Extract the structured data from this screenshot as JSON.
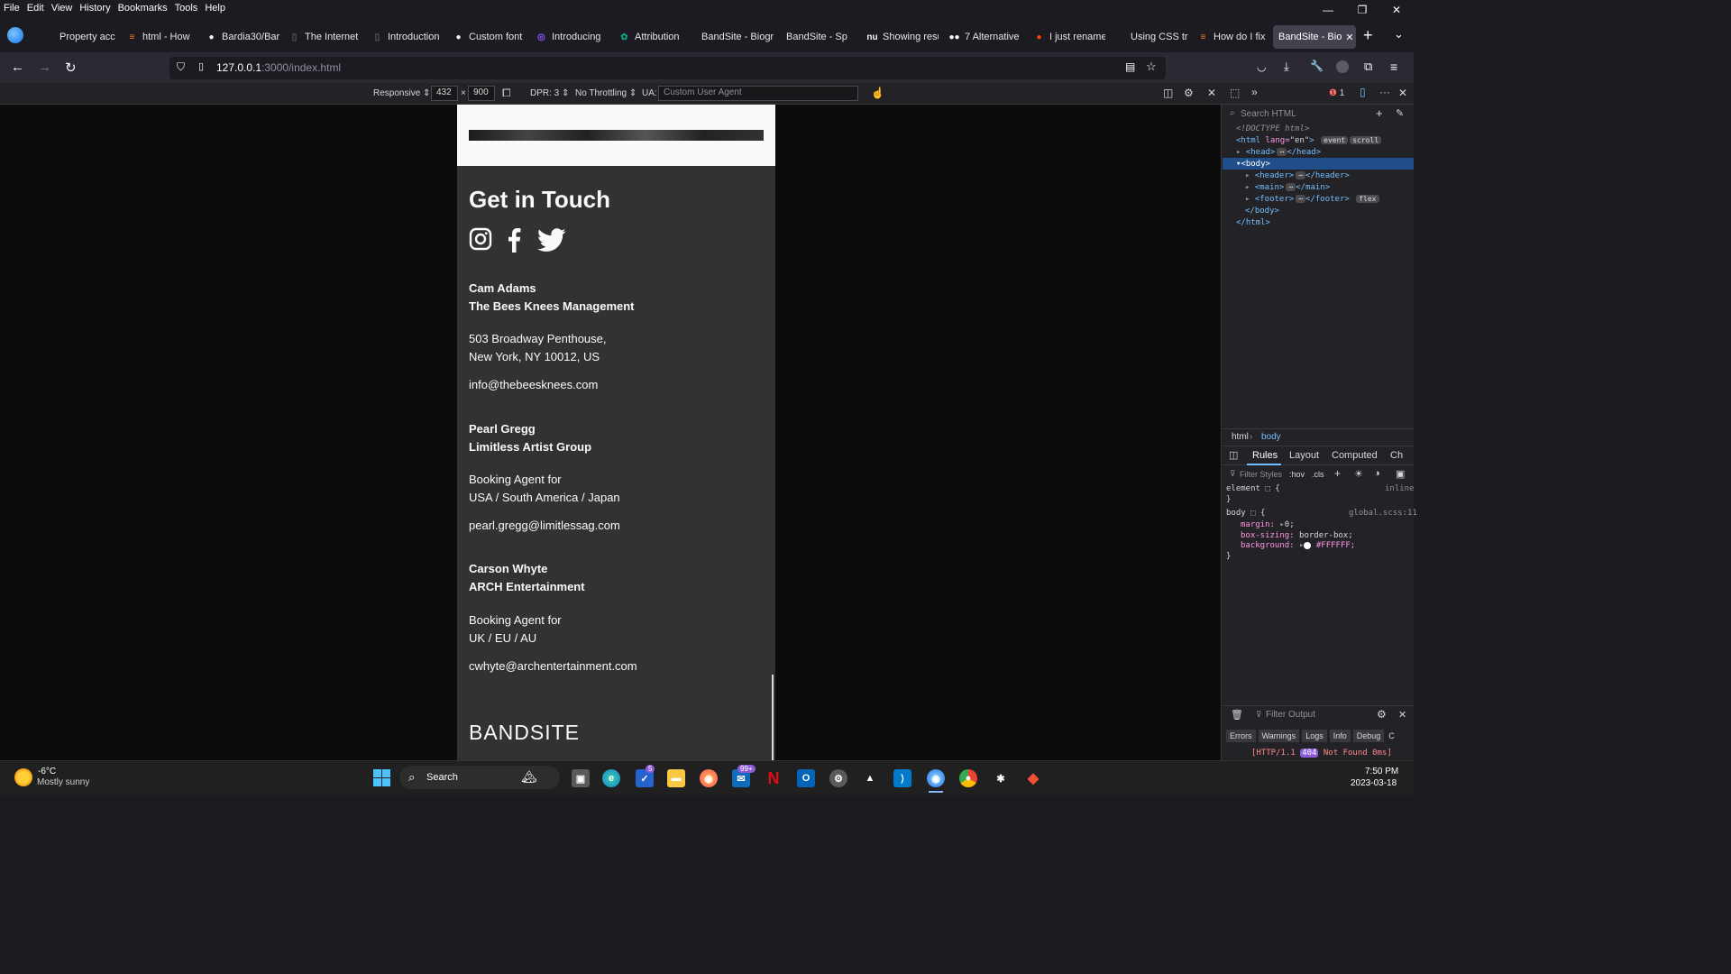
{
  "menu": [
    "File",
    "Edit",
    "View",
    "History",
    "Bookmarks",
    "Tools",
    "Help"
  ],
  "window_controls": {
    "minimize": "—",
    "restore": "❐",
    "close": "✕"
  },
  "tabs": [
    {
      "label": "Property acc",
      "icon": "medium-icon",
      "glyph": "M",
      "color": "#1c1b22"
    },
    {
      "label": "html - How",
      "icon": "stackoverflow-icon",
      "glyph": "≡",
      "color": "#f48024"
    },
    {
      "label": "Bardia30/Bar",
      "icon": "github-icon",
      "glyph": "●",
      "color": "#fbfbfe"
    },
    {
      "label": "The Internet",
      "icon": "page-icon",
      "glyph": "▯",
      "color": "#5b5b66"
    },
    {
      "label": "Introduction",
      "icon": "page-icon",
      "glyph": "▯",
      "color": "#5b5b66"
    },
    {
      "label": "Custom font",
      "icon": "github-icon",
      "glyph": "●",
      "color": "#fbfbfe"
    },
    {
      "label": "Introducing",
      "icon": "firefox-icon",
      "glyph": "◎",
      "color": "#9059ff"
    },
    {
      "label": "Attribution",
      "icon": "chatgpt-icon",
      "glyph": "✿",
      "color": "#10a37f"
    },
    {
      "label": "BandSite - Biogr",
      "icon": "",
      "glyph": "",
      "color": ""
    },
    {
      "label": "BandSite - Sp",
      "icon": "",
      "glyph": "",
      "color": ""
    },
    {
      "label": "Showing resu",
      "icon": "notion-icon",
      "glyph": "nu",
      "color": "#fbfbfe"
    },
    {
      "label": "7 Alternative",
      "icon": "medium-icon",
      "glyph": "●●",
      "color": "#fbfbfe"
    },
    {
      "label": "I just rename",
      "icon": "reddit-icon",
      "glyph": "●",
      "color": "#ff4500"
    },
    {
      "label": "Using CSS tra",
      "icon": "medium-icon",
      "glyph": "M",
      "color": "#1c1b22"
    },
    {
      "label": "How do I fix",
      "icon": "stackoverflow-icon",
      "glyph": "≡",
      "color": "#f48024"
    },
    {
      "label": "BandSite - Bio",
      "icon": "",
      "glyph": "",
      "color": ""
    }
  ],
  "url": {
    "host": "127.0.0.1",
    "rest": ":3000/index.html"
  },
  "rdm": {
    "device": "Responsive",
    "width": "432",
    "height": "900",
    "dpr": "DPR: 3",
    "throttle": "No Throttling",
    "ua_label": "UA:",
    "ua_placeholder": "Custom User Agent"
  },
  "site": {
    "heading": "Get in Touch",
    "contacts": [
      {
        "name": "Cam Adams",
        "org": "The Bees Knees Management",
        "line1": "503 Broadway Penthouse,",
        "line2": "New York, NY 10012, US",
        "email": "info@thebeesknees.com"
      },
      {
        "name": "Pearl Gregg",
        "org": "Limitless Artist Group",
        "line1": "Booking Agent for",
        "line2": "USA / South America / Japan",
        "email": "pearl.gregg@limitlessag.com"
      },
      {
        "name": "Carson Whyte",
        "org": "ARCH Entertainment",
        "line1": "Booking Agent for",
        "line2": "UK / EU / AU",
        "email": "cwhyte@archentertainment.com"
      }
    ],
    "logo": "BANDSITE"
  },
  "devtools": {
    "search_placeholder": "Search HTML",
    "tree": {
      "doctype": "<!DOCTYPE html>",
      "html_open": "<html",
      "lang_attr": "lang=",
      "lang_val": "\"en\"",
      "html_close": ">",
      "event": "event",
      "scroll": "scroll",
      "head": "<head>",
      "head_close": "</head>",
      "body": "<body>",
      "header": "<header>",
      "header_close": "</header>",
      "main": "<main>",
      "main_close": "</main>",
      "footer": "<footer>",
      "footer_close": "</footer>",
      "flex": "flex",
      "body_close": "</body>",
      "html_end": "</html>"
    },
    "breadcrumb": [
      "html",
      "body"
    ],
    "tabs": [
      "Rules",
      "Layout",
      "Computed",
      "Ch"
    ],
    "filter_placeholder": "Filter Styles",
    "hov": ":hov",
    "cls": ".cls",
    "rules": {
      "element": "element",
      "inline": "inline",
      "body": "body",
      "source": "global.scss:11",
      "margin_prop": "margin:",
      "margin_val": "0;",
      "boxsizing_prop": "box-sizing:",
      "boxsizing_val": "border-box;",
      "bg_prop": "background:",
      "bg_val": "#FFFFFF;"
    },
    "console_filter": "Filter Output",
    "console_tabs": [
      "Errors",
      "Warnings",
      "Logs",
      "Info",
      "Debug",
      "C"
    ],
    "console_msg_pre": "[HTTP/1.1",
    "console_code": "404",
    "console_msg_post": "Not Found 0ms]",
    "error_count": "1"
  },
  "taskbar": {
    "temp": "-6°C",
    "weather": "Mostly sunny",
    "search": "Search",
    "time": "7:50 PM",
    "date": "2023-03-18",
    "badge_mail": "99+",
    "badge_todo": "5"
  }
}
